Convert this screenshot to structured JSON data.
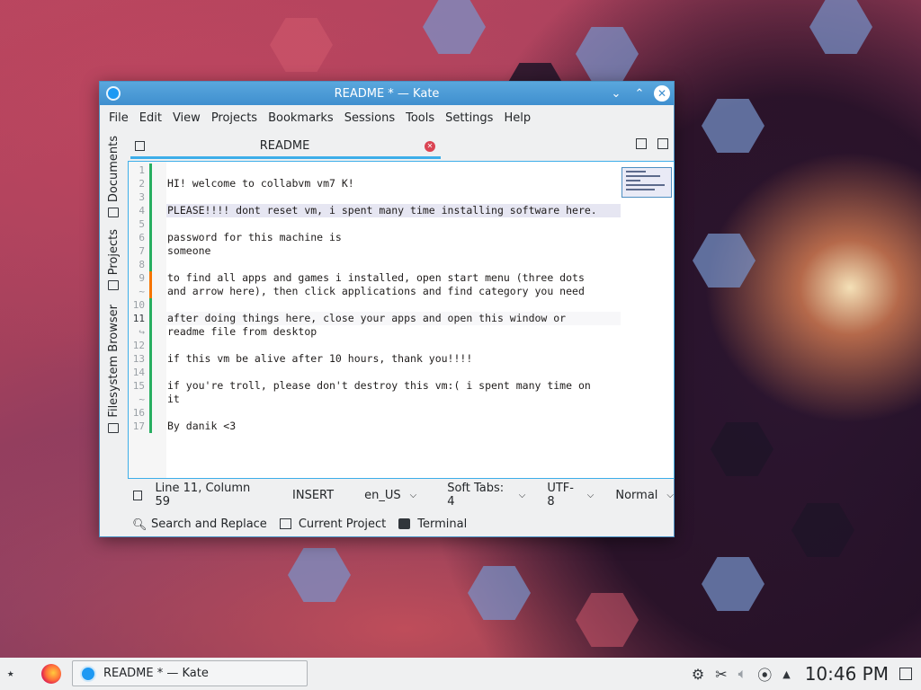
{
  "window": {
    "title": "README * — Kate",
    "menu": [
      "File",
      "Edit",
      "View",
      "Projects",
      "Bookmarks",
      "Sessions",
      "Tools",
      "Settings",
      "Help"
    ],
    "side_tabs": [
      "Documents",
      "Projects",
      "Filesystem Browser"
    ],
    "tab": {
      "name": "README"
    },
    "editor": {
      "line_numbers": [
        "1",
        "2",
        "3",
        "4",
        "5",
        "6",
        "7",
        "8",
        "9",
        "~",
        "10",
        "11",
        "↪",
        "12",
        "13",
        "14",
        "15",
        "~",
        "16",
        "17"
      ],
      "lines": [
        "",
        "HI! welcome to collabvm vm7 K!",
        "",
        "PLEASE!!!! dont reset vm, i spent many time installing software here.",
        "",
        "password for this machine is",
        "someone",
        "",
        "to find all apps and games i installed, open start menu (three dots",
        "and arrow here), then click applications and find category you need",
        "",
        "after doing things here, close your apps and open this window or",
        "readme file from desktop",
        "",
        "if this vm be alive after 10 hours, thank you!!!!",
        "",
        "if you're troll, please don't destroy this vm:( i spent many time on",
        "it",
        "",
        "By danik <3"
      ],
      "highlighted_line": "PLEASE!!!! dont reset vm, i spent many time installing software here.",
      "current_line": "11"
    },
    "status": {
      "position": "Line 11, Column 59",
      "mode": "INSERT",
      "language": "en_US",
      "indent": "Soft Tabs: 4",
      "encoding": "UTF-8",
      "input_mode": "Normal"
    },
    "toolviews": [
      "Search and Replace",
      "Current Project",
      "Terminal"
    ]
  },
  "taskbar": {
    "task_label": "README * — Kate",
    "clock": "10:46 PM"
  },
  "colors": {
    "accent": "#3daee9",
    "titlebar": "#4b9bd6",
    "close_tab": "#da4453",
    "modified_green": "#27ae60",
    "modified_orange": "#f67400"
  },
  "icons": [
    "kate-icon",
    "minimize-icon",
    "maximize-icon",
    "close-icon",
    "save-icon",
    "new-file-icon",
    "split-view-icon",
    "search-icon",
    "project-icon",
    "terminal-icon",
    "launcher-icon",
    "firefox-icon",
    "network-icon",
    "clipboard-icon",
    "volume-icon",
    "updates-icon",
    "tray-arrow-icon",
    "show-desktop-icon"
  ]
}
